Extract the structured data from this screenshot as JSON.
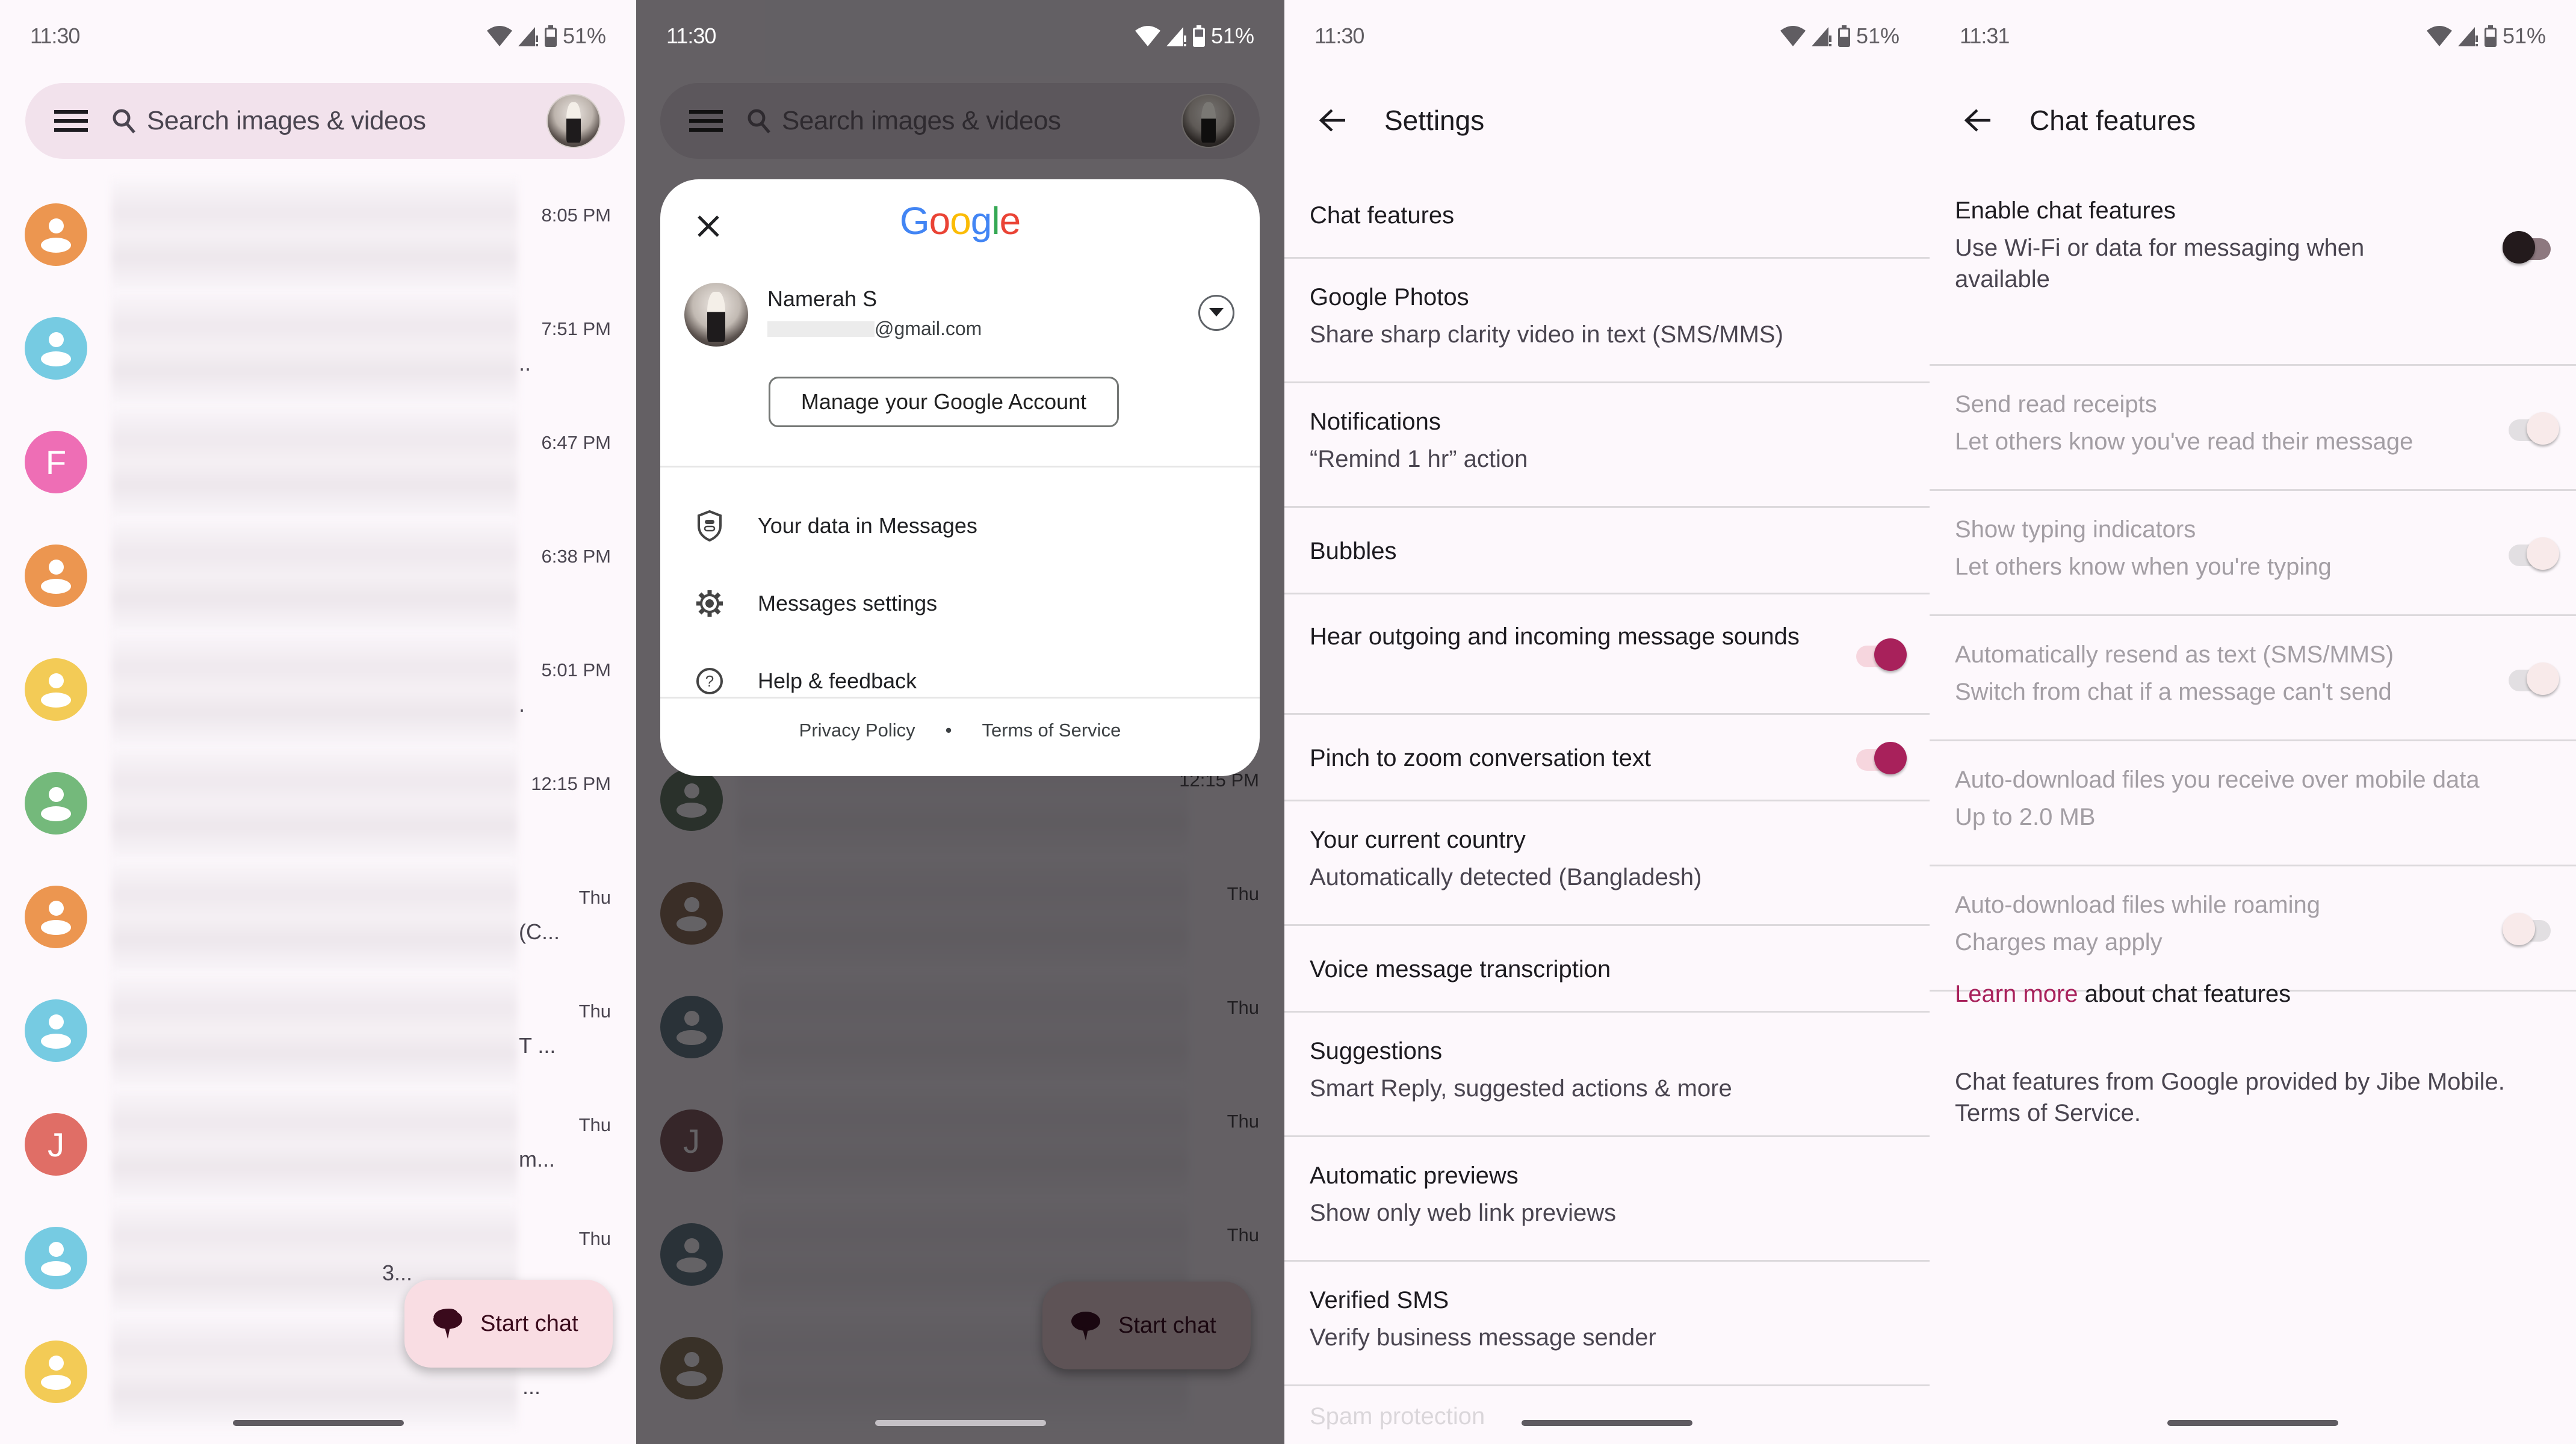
{
  "colors": {
    "accent": "#a8215b",
    "background": "#fdf8fc",
    "search_bar": "#f2e2ec",
    "fab": "#f9dde3",
    "google_blue": "#4285f4",
    "google_red": "#ea4335",
    "google_yellow": "#fbbc05",
    "google_green": "#34a853"
  },
  "panel1": {
    "status": {
      "time": "11:30",
      "battery": "51%",
      "icons": [
        "wifi-icon",
        "signal-alert-icon",
        "battery-icon"
      ]
    },
    "search": {
      "menu_icon": "hamburger-menu-icon",
      "search_icon": "search-icon",
      "placeholder": "Search images & videos",
      "account_icon": "account-avatar"
    },
    "conversations": [
      {
        "avatar_type": "person",
        "avatar_color": "#ec9650",
        "letter": "",
        "time": "8:05 PM",
        "trailing": ""
      },
      {
        "avatar_type": "person",
        "avatar_color": "#76cbe2",
        "letter": "",
        "time": "7:51 PM",
        "trailing": ".."
      },
      {
        "avatar_type": "letter",
        "avatar_color": "#ee6eb5",
        "letter": "F",
        "time": "6:47 PM",
        "trailing": ""
      },
      {
        "avatar_type": "person",
        "avatar_color": "#ec9650",
        "letter": "",
        "time": "6:38 PM",
        "trailing": ""
      },
      {
        "avatar_type": "person",
        "avatar_color": "#f3cb56",
        "letter": "",
        "time": "5:01 PM",
        "trailing": "."
      },
      {
        "avatar_type": "person",
        "avatar_color": "#74b97b",
        "letter": "",
        "time": "12:15 PM",
        "trailing": ""
      },
      {
        "avatar_type": "person",
        "avatar_color": "#ec9650",
        "letter": "",
        "time": "Thu",
        "trailing": "(C..."
      },
      {
        "avatar_type": "person",
        "avatar_color": "#76cbe2",
        "letter": "",
        "time": "Thu",
        "trailing": "T ..."
      },
      {
        "avatar_type": "letter",
        "avatar_color": "#e06e66",
        "letter": "J",
        "time": "Thu",
        "trailing": "m..."
      },
      {
        "avatar_type": "person",
        "avatar_color": "#76cbe2",
        "letter": "",
        "time": "Thu",
        "trailing": "3..."
      },
      {
        "avatar_type": "person",
        "avatar_color": "#f3cb56",
        "letter": "",
        "time": "",
        "trailing": "..."
      }
    ],
    "fab": {
      "icon": "chat-bubbles-icon",
      "label": "Start chat"
    }
  },
  "panel2": {
    "status": {
      "time": "11:30",
      "battery": "51%"
    },
    "search": {
      "placeholder": "Search images & videos"
    },
    "dialog": {
      "close_icon": "close-icon",
      "logo": [
        "G",
        "o",
        "o",
        "g",
        "l",
        "e"
      ],
      "user_name": "Namerah S",
      "user_email_suffix": "@gmail.com",
      "manage_button": "Manage your Google Account",
      "menu": [
        {
          "icon": "shield-data-icon",
          "label": "Your data in Messages"
        },
        {
          "icon": "gear-icon",
          "label": "Messages settings"
        },
        {
          "icon": "help-circle-icon",
          "label": "Help & feedback"
        }
      ],
      "footer": {
        "privacy": "Privacy Policy",
        "separator": "•",
        "terms": "Terms of Service"
      }
    },
    "background_conversations": [
      {
        "avatar_color": "#2f4f2f",
        "time": "12:15 PM",
        "letter": ""
      },
      {
        "avatar_color": "#6a4521",
        "time": "Thu",
        "letter": ""
      },
      {
        "avatar_color": "#30555f",
        "time": "Thu",
        "letter": ""
      },
      {
        "avatar_color": "#5a2a28",
        "time": "Thu",
        "letter": "J"
      },
      {
        "avatar_color": "#30555f",
        "time": "Thu",
        "letter": ""
      },
      {
        "avatar_color": "#665024",
        "time": "",
        "letter": ""
      }
    ],
    "fab": {
      "label": "Start chat"
    }
  },
  "panel3": {
    "status": {
      "time": "11:30",
      "battery": "51%"
    },
    "appbar": {
      "back_icon": "arrow-back-icon",
      "title": "Settings"
    },
    "rows": [
      {
        "title": "Chat features",
        "subtitle": ""
      },
      {
        "title": "Google Photos",
        "subtitle": "Share sharp clarity video in text (SMS/MMS)"
      },
      {
        "title": "Notifications",
        "subtitle": "“Remind 1 hr” action"
      },
      {
        "title": "Bubbles",
        "subtitle": ""
      },
      {
        "title": "Hear outgoing and incoming message sounds",
        "subtitle": "",
        "toggle": "on"
      },
      {
        "title": "Pinch to zoom conversation text",
        "subtitle": "",
        "toggle": "on"
      },
      {
        "title": "Your current country",
        "subtitle": "Automatically detected (Bangladesh)"
      },
      {
        "title": "Voice message transcription",
        "subtitle": ""
      },
      {
        "title": "Suggestions",
        "subtitle": "Smart Reply, suggested actions & more"
      },
      {
        "title": "Automatic previews",
        "subtitle": "Show only web link previews"
      },
      {
        "title": "Verified SMS",
        "subtitle": "Verify business message sender"
      },
      {
        "title": "Spam protection",
        "subtitle": ""
      }
    ]
  },
  "panel4": {
    "status": {
      "time": "11:31",
      "battery": "51%"
    },
    "appbar": {
      "back_icon": "arrow-back-icon",
      "title": "Chat features"
    },
    "rows": [
      {
        "title": "Enable chat features",
        "subtitle": "Use Wi-Fi or data for messaging when available",
        "toggle": "off",
        "enabled": true
      },
      {
        "title": "Send read receipts",
        "subtitle": "Let others know you've read their message",
        "toggle": "on",
        "enabled": false
      },
      {
        "title": "Show typing indicators",
        "subtitle": "Let others know when you're typing",
        "toggle": "on",
        "enabled": false
      },
      {
        "title": "Automatically resend as text (SMS/MMS)",
        "subtitle": "Switch from chat if a message can't send",
        "toggle": "on",
        "enabled": false
      },
      {
        "title": "Auto-download files you receive over mobile data",
        "subtitle": "Up to 2.0 MB",
        "enabled": false
      },
      {
        "title": "Auto-download files while roaming",
        "subtitle": "Charges may apply",
        "toggle": "off",
        "enabled": false
      }
    ],
    "learn_more": {
      "link": "Learn more",
      "rest": " about chat features"
    },
    "legal": "Chat features from Google provided by Jibe Mobile. Terms of Service."
  }
}
